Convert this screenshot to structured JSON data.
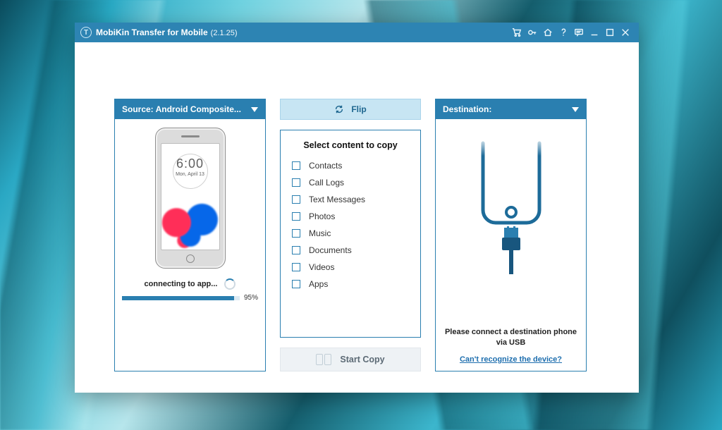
{
  "titlebar": {
    "app_name": "MobiKin Transfer for Mobile",
    "version": "(2.1.25)",
    "logo_letter": "T"
  },
  "source": {
    "header_label": "Source: Android Composite...",
    "phone_clock_time": "6:00",
    "phone_clock_date": "Mon, April 13",
    "status_text": "connecting to app...",
    "progress_pct": 95
  },
  "center": {
    "flip_label": "Flip",
    "content_title": "Select content to copy",
    "items": [
      {
        "label": "Contacts"
      },
      {
        "label": "Call Logs"
      },
      {
        "label": "Text Messages"
      },
      {
        "label": "Photos"
      },
      {
        "label": "Music"
      },
      {
        "label": "Documents"
      },
      {
        "label": "Videos"
      },
      {
        "label": "Apps"
      }
    ],
    "start_label": "Start Copy"
  },
  "destination": {
    "header_label": "Destination:",
    "message_line1": "Please connect a destination phone",
    "message_line2": "via USB",
    "link_text": "Can't recognize the device?"
  },
  "colors": {
    "primary": "#2a7fb0",
    "titlebar": "#2d84b3",
    "flip_bg": "#c7e5f3"
  }
}
